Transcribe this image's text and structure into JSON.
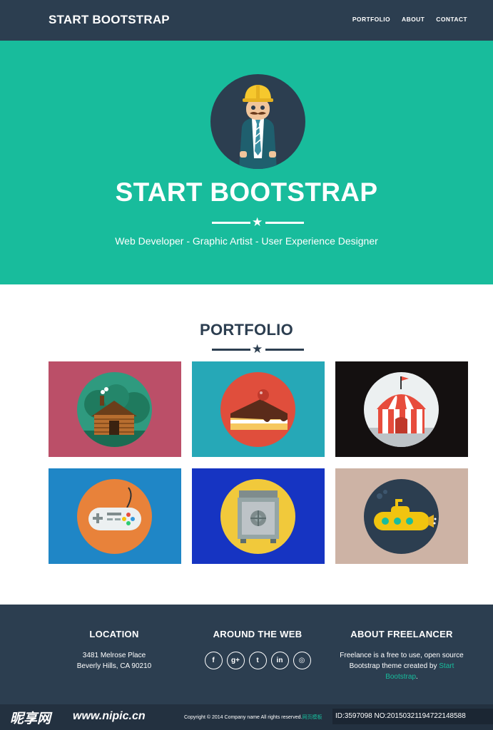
{
  "navbar": {
    "brand": "START BOOTSTRAP",
    "links": [
      "PORTFOLIO",
      "ABOUT",
      "CONTACT"
    ]
  },
  "header": {
    "title": "START BOOTSTRAP",
    "subtitle": "Web Developer - Graphic Artist - User Experience Designer",
    "avatar_icon": "construction-worker-avatar"
  },
  "portfolio": {
    "title": "PORTFOLIO",
    "items": [
      {
        "icon": "log-cabin-icon",
        "bg": "#bb4f68"
      },
      {
        "icon": "cake-slice-icon",
        "bg": "#26a8b7"
      },
      {
        "icon": "circus-tent-icon",
        "bg": "#141010"
      },
      {
        "icon": "game-controller-icon",
        "bg": "#1f86c6"
      },
      {
        "icon": "safe-icon",
        "bg": "#1634c2"
      },
      {
        "icon": "submarine-icon",
        "bg": "#cdb3a5"
      }
    ]
  },
  "footer": {
    "location": {
      "heading": "LOCATION",
      "line1": "3481 Melrose Place",
      "line2": "Beverly Hills, CA 90210"
    },
    "around": {
      "heading": "AROUND THE WEB",
      "social": [
        "f",
        "g+",
        "t",
        "in",
        "◎"
      ]
    },
    "about": {
      "heading": "ABOUT FREELANCER",
      "text1": "Freelance is a free to use, open source",
      "text2": "Bootstrap theme created by ",
      "link": "Start",
      "link2": "Bootstrap",
      "text3": "."
    },
    "copyright": "Copyright © 2014 Company name All rights reserved.",
    "copyright_extra": "网页模板"
  },
  "watermark": {
    "logo": "昵享网",
    "url": "www.nipic.cn",
    "id": "ID:3597098 NO:20150321194722148588"
  },
  "colors": {
    "primary": "#2c3e50",
    "accent": "#18bc9c"
  }
}
